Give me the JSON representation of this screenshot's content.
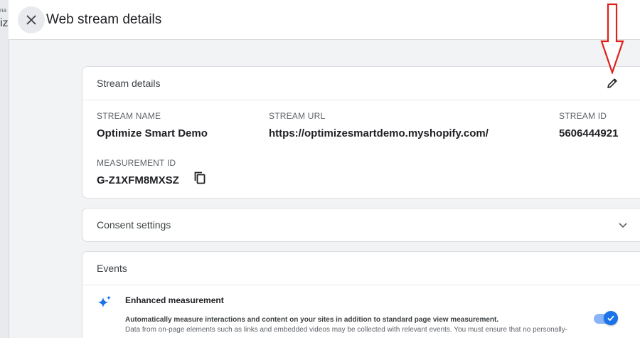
{
  "background": {
    "label_top": "na",
    "label_big": "iz"
  },
  "panel": {
    "title": "Web stream details"
  },
  "stream_details": {
    "header": "Stream details",
    "stream_name": {
      "label": "STREAM NAME",
      "value": "Optimize Smart Demo"
    },
    "stream_url": {
      "label": "STREAM URL",
      "value": "https://optimizesmartdemo.myshopify.com/"
    },
    "stream_id": {
      "label": "STREAM ID",
      "value": "5606444921"
    },
    "measurement_id": {
      "label": "MEASUREMENT ID",
      "value": "G-Z1XFM8MXSZ"
    }
  },
  "consent": {
    "header": "Consent settings"
  },
  "events": {
    "header": "Events",
    "enhanced_measurement": {
      "title": "Enhanced measurement",
      "description": "Automatically measure interactions and content on your sites in addition to standard page view measurement.",
      "note": "Data from on-page elements such as links and embedded videos may be collected with relevant events. You must ensure that no personally-",
      "enabled": true
    }
  },
  "colors": {
    "accent": "#1a73e8",
    "annotation_arrow": "#e0201b"
  },
  "icons": [
    "close-icon",
    "pencil-icon",
    "copy-icon",
    "chevron-down-icon",
    "sparkle-icon"
  ]
}
